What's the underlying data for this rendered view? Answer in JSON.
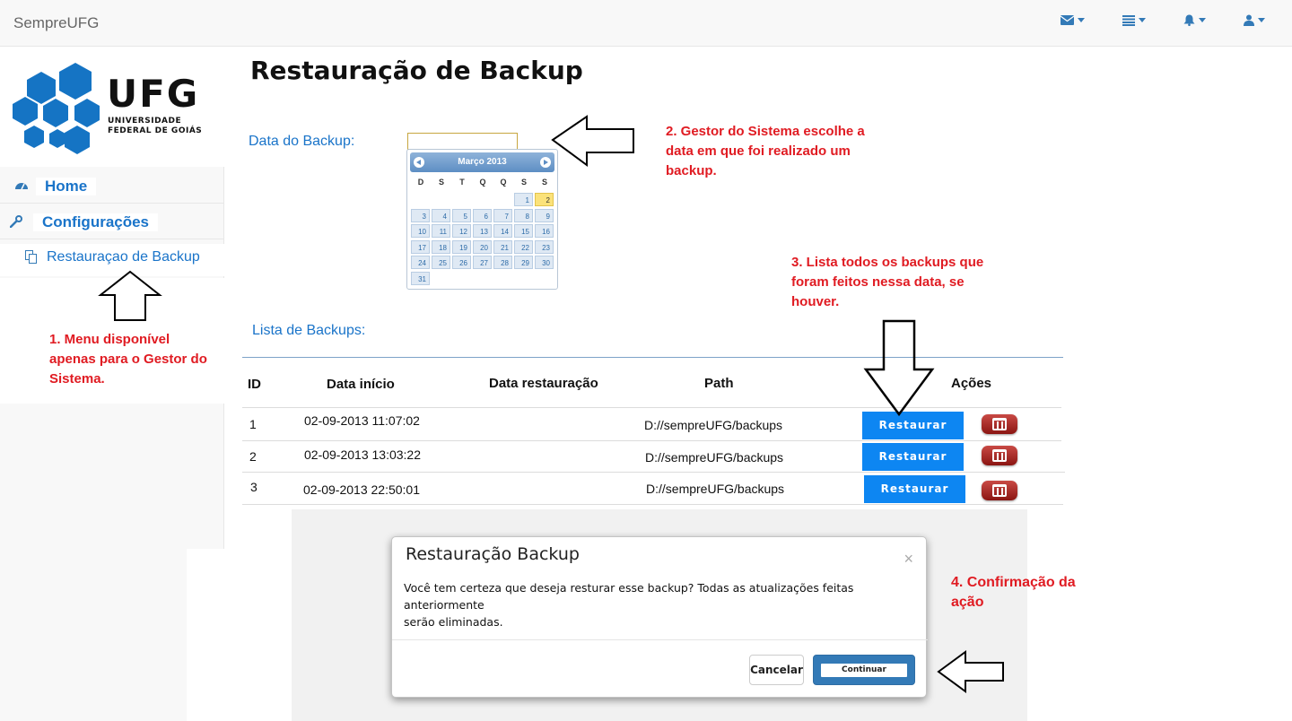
{
  "navbar": {
    "brand": "SempreUFG",
    "icons": [
      "envelope-icon",
      "list-icon",
      "bell-icon",
      "user-icon"
    ]
  },
  "sidebar": {
    "logo_title": "UFG",
    "logo_sub_line1": "UNIVERSIDADE",
    "logo_sub_line2": "FEDERAL DE GOIÁS",
    "items": [
      {
        "label": "Home",
        "icon": "dashboard-icon"
      },
      {
        "label": "Configurações",
        "icon": "wrench-icon"
      },
      {
        "label": "Restauraçao de Backup",
        "icon": "copy-icon"
      }
    ]
  },
  "annotations": {
    "a1": [
      "1. Menu disponível",
      "apenas para o Gestor do",
      "Sistema."
    ],
    "a2": [
      "2. Gestor do Sistema escolhe a",
      "data em que foi realizado um",
      "backup."
    ],
    "a3": [
      "3. Lista todos os backups que",
      "foram feitos nessa data, se",
      "houver."
    ],
    "a4": [
      "4. Confirmação da",
      "ação"
    ]
  },
  "page": {
    "title": "Restauração de Backup",
    "date_label": "Data do Backup:",
    "list_label": "Lista de Backups:"
  },
  "calendar": {
    "month_label": "Março 2013",
    "weekdays": [
      "D",
      "S",
      "T",
      "Q",
      "Q",
      "S",
      "S"
    ],
    "first_weekday_index": 5,
    "days_in_month": 31,
    "highlighted_day": 2
  },
  "table": {
    "headers": {
      "id": "ID",
      "start": "Data início",
      "restore": "Data restauração",
      "path": "Path",
      "actions": "Ações"
    },
    "rows": [
      {
        "id": "1",
        "start": "02-09-2013 11:07:02",
        "restore": "",
        "path": "D://sempreUFG/backups",
        "action": "Restaurar"
      },
      {
        "id": "2",
        "start": "02-09-2013 13:03:22",
        "restore": "",
        "path": "D://sempreUFG/backups",
        "action": "Restaurar"
      },
      {
        "id": "3",
        "start": "02-09-2013 22:50:01",
        "restore": "",
        "path": "D://sempreUFG/backups",
        "action": "Restaurar"
      }
    ]
  },
  "modal": {
    "title": "Restauração Backup",
    "close": "×",
    "body_line1": "Você tem certeza que deseja resturar esse backup? Todas as atualizações feitas anteriormente",
    "body_line2": "serão eliminadas.",
    "cancel": "Cancelar",
    "continue": "Continuar"
  }
}
